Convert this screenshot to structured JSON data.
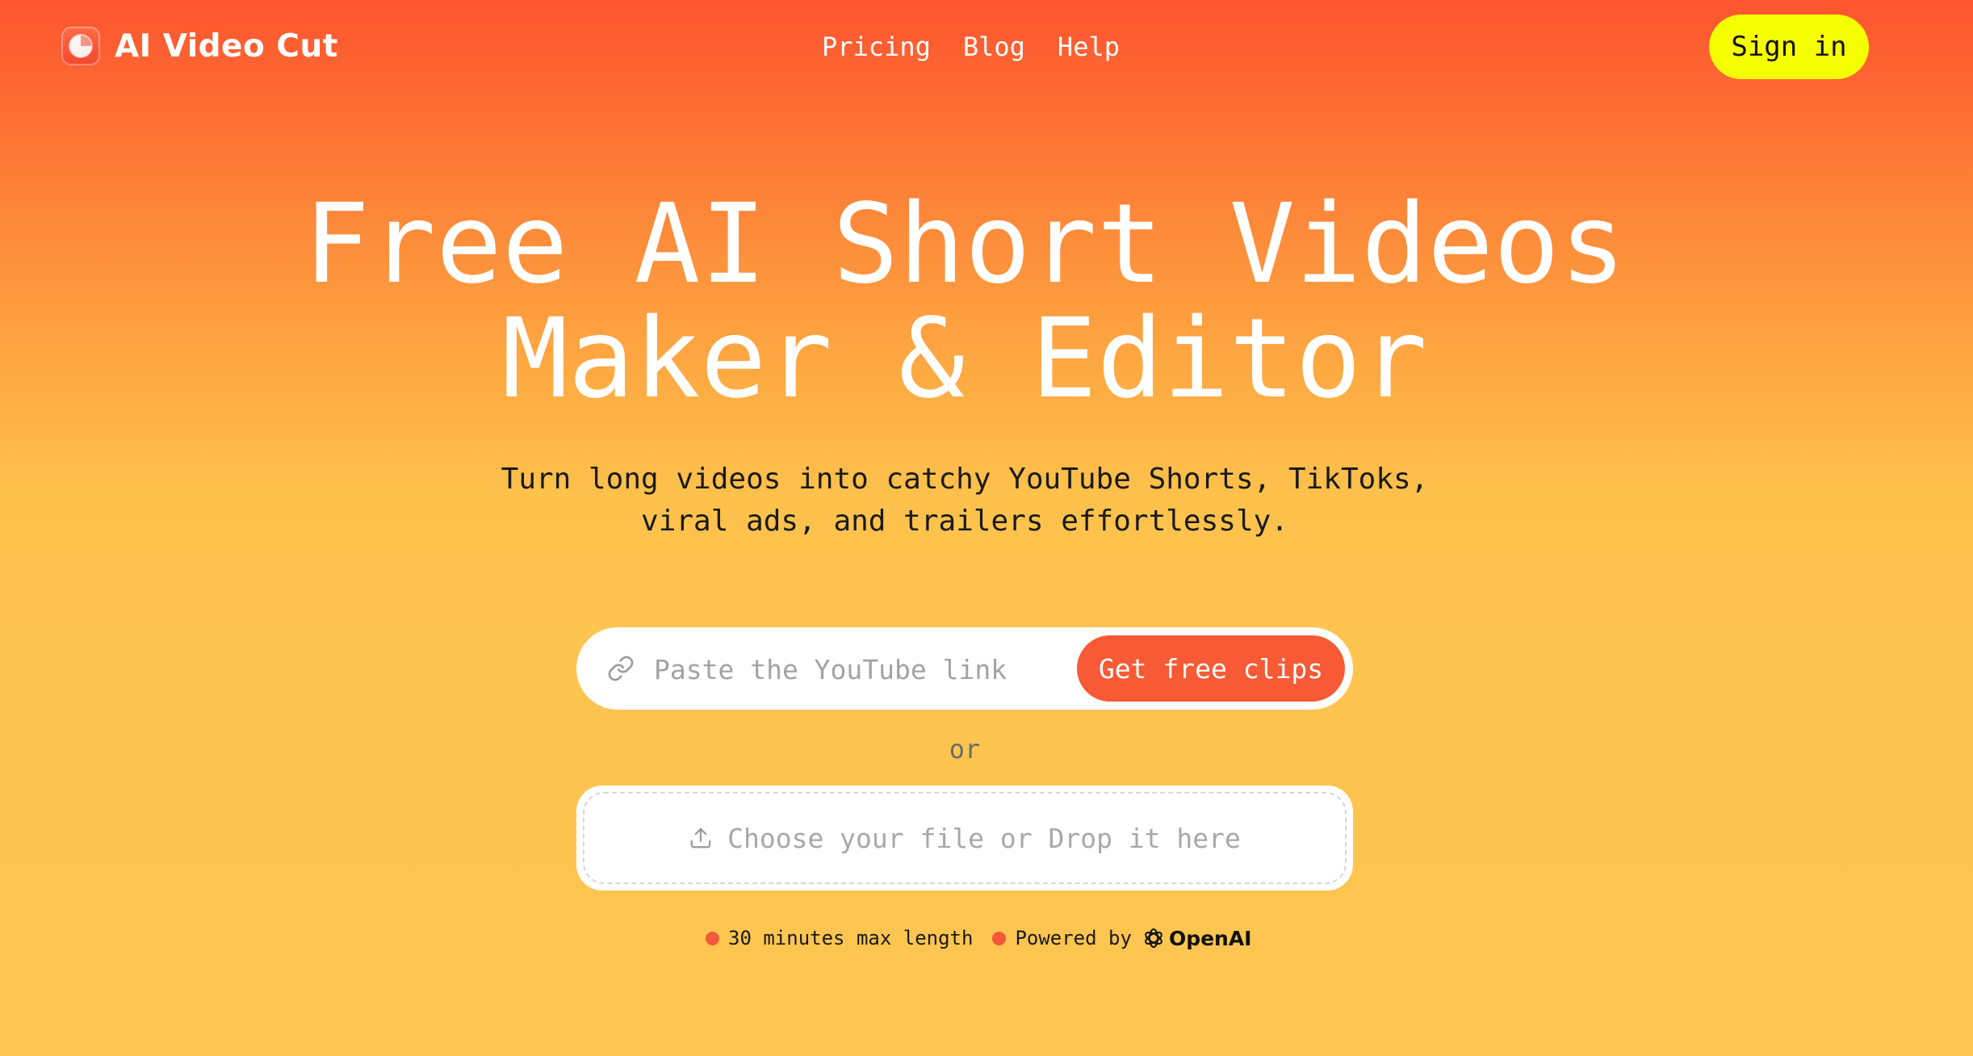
{
  "brand": {
    "name": "AI Video Cut",
    "logo_icon": "pie-clock-icon"
  },
  "nav": {
    "items": [
      "Pricing",
      "Blog",
      "Help"
    ]
  },
  "header": {
    "signin_label": "Sign in"
  },
  "hero": {
    "title_line1": "Free AI Short Videos",
    "title_line2": "Maker & Editor",
    "subtitle_line1": "Turn long videos into catchy YouTube Shorts, TikToks,",
    "subtitle_line2": "viral ads, and trailers effortlessly."
  },
  "url_form": {
    "placeholder": "Paste the YouTube link",
    "value": "",
    "icon": "link-icon",
    "button_label": "Get free clips"
  },
  "divider_text": "or",
  "upload": {
    "icon": "upload-icon",
    "label": "Choose your file or Drop it here"
  },
  "info": {
    "max_length": "30 minutes max length",
    "powered_by": "Powered by",
    "provider": "OpenAI"
  },
  "colors": {
    "accent": "#f75a34",
    "signin_bg": "#f6ff00",
    "gradient_top": "#fd5530",
    "gradient_bottom": "#fec551"
  }
}
